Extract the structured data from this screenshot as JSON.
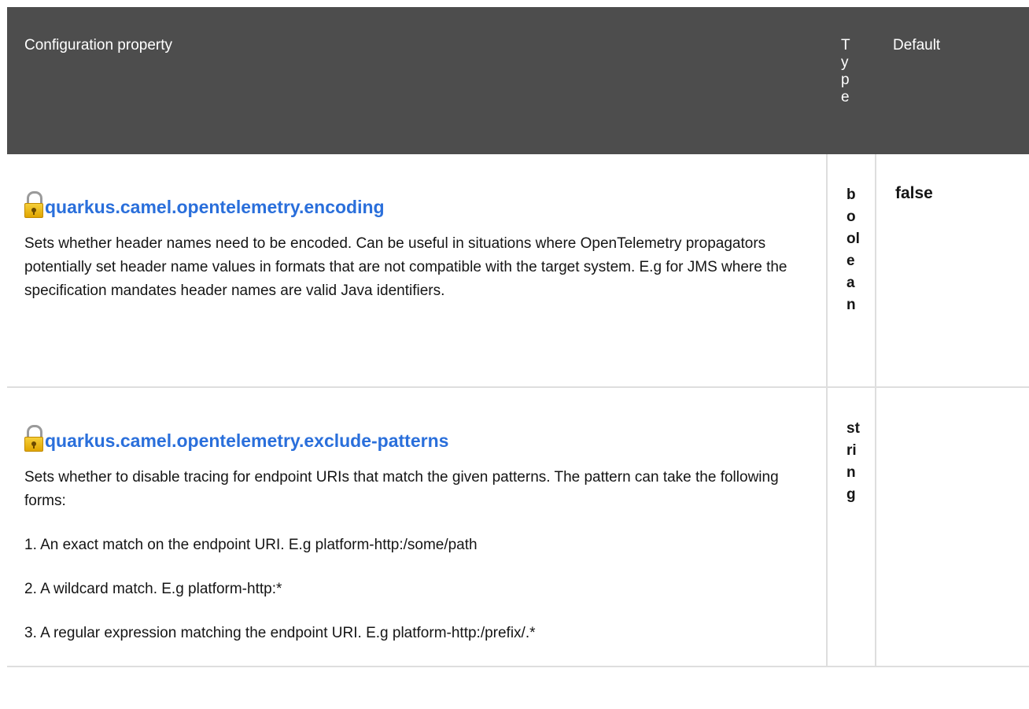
{
  "table": {
    "headers": {
      "property": "Configuration property",
      "type": "Type",
      "default": "Default"
    },
    "rows": [
      {
        "property": "quarkus.camel.opentelemetry.encoding",
        "icon": "lock-icon",
        "description": [
          "Sets whether header names need to be encoded. Can be useful in situations where OpenTelemetry propagators potentially set header name values in formats that are not compatible with the target system. E.g for JMS where the specification mandates header names are valid Java identifiers."
        ],
        "type": "boolean",
        "default": "false"
      },
      {
        "property": "quarkus.camel.opentelemetry.exclude-patterns",
        "icon": "lock-icon",
        "description": [
          "Sets whether to disable tracing for endpoint URIs that match the given patterns. The pattern can take the following forms:",
          "1. An exact match on the endpoint URI. E.g platform-http:/some/path",
          "2. A wildcard match. E.g platform-http:*",
          "3. A regular expression matching the endpoint URI. E.g platform-http:/prefix/.*"
        ],
        "type": "string",
        "default": ""
      }
    ]
  },
  "colors": {
    "header_bg": "#4d4d4d",
    "link": "#2a6fdb",
    "border": "#dedede"
  }
}
